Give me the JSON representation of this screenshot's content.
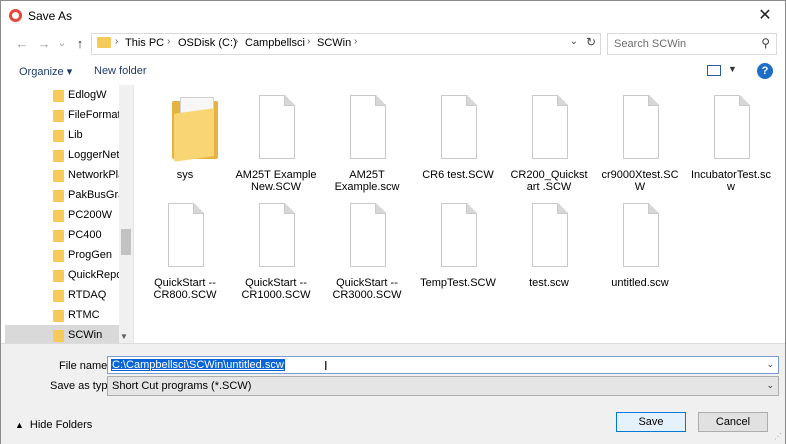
{
  "window": {
    "title": "Save As",
    "close_glyph": "✕"
  },
  "nav": {
    "back": "←",
    "forward": "→",
    "recent": "⌄",
    "up": "↑",
    "breadcrumbs": [
      "This PC",
      "OSDisk (C:)",
      "Campbellsci",
      "SCWin"
    ],
    "separator": "›",
    "search_placeholder": "Search SCWin"
  },
  "toolbar": {
    "organize": "Organize ▾",
    "new_folder": "New folder",
    "help": "?"
  },
  "sidebar": {
    "items": [
      {
        "label": "EdlogW"
      },
      {
        "label": "FileFormatC"
      },
      {
        "label": "Lib"
      },
      {
        "label": "LoggerNet"
      },
      {
        "label": "NetworkPla"
      },
      {
        "label": "PakBusGrap"
      },
      {
        "label": "PC200W"
      },
      {
        "label": "PC400"
      },
      {
        "label": "ProgGen"
      },
      {
        "label": "QuickRepor"
      },
      {
        "label": "RTDAQ"
      },
      {
        "label": "RTMC"
      },
      {
        "label": "SCWin",
        "selected": true
      }
    ]
  },
  "files": [
    {
      "name": "sys",
      "kind": "folder"
    },
    {
      "name": "AM25T Example New.SCW",
      "kind": "file"
    },
    {
      "name": "AM25T Example.scw",
      "kind": "file"
    },
    {
      "name": "CR6 test.SCW",
      "kind": "file"
    },
    {
      "name": "CR200_Quickstart .SCW",
      "kind": "file"
    },
    {
      "name": "cr9000Xtest.SCW",
      "kind": "file"
    },
    {
      "name": "IncubatorTest.scw",
      "kind": "file"
    },
    {
      "name": "QuickStart -- CR800.SCW",
      "kind": "file"
    },
    {
      "name": "QuickStart -- CR1000.SCW",
      "kind": "file"
    },
    {
      "name": "QuickStart -- CR3000.SCW",
      "kind": "file"
    },
    {
      "name": "TempTest.SCW",
      "kind": "file"
    },
    {
      "name": "test.scw",
      "kind": "file"
    },
    {
      "name": "untitled.scw",
      "kind": "file"
    }
  ],
  "form": {
    "file_name_label": "File name:",
    "file_name_value": "C:\\Campbellsci\\SCWin\\untitled.scw",
    "save_type_label": "Save as type:",
    "save_type_value": "Short Cut programs (*.SCW)"
  },
  "footer": {
    "hide_folders": "Hide Folders",
    "save": "Save",
    "cancel": "Cancel"
  },
  "colors": {
    "accent": "#0078d7",
    "selection": "#0a64d6",
    "folder": "#f5c95a"
  }
}
